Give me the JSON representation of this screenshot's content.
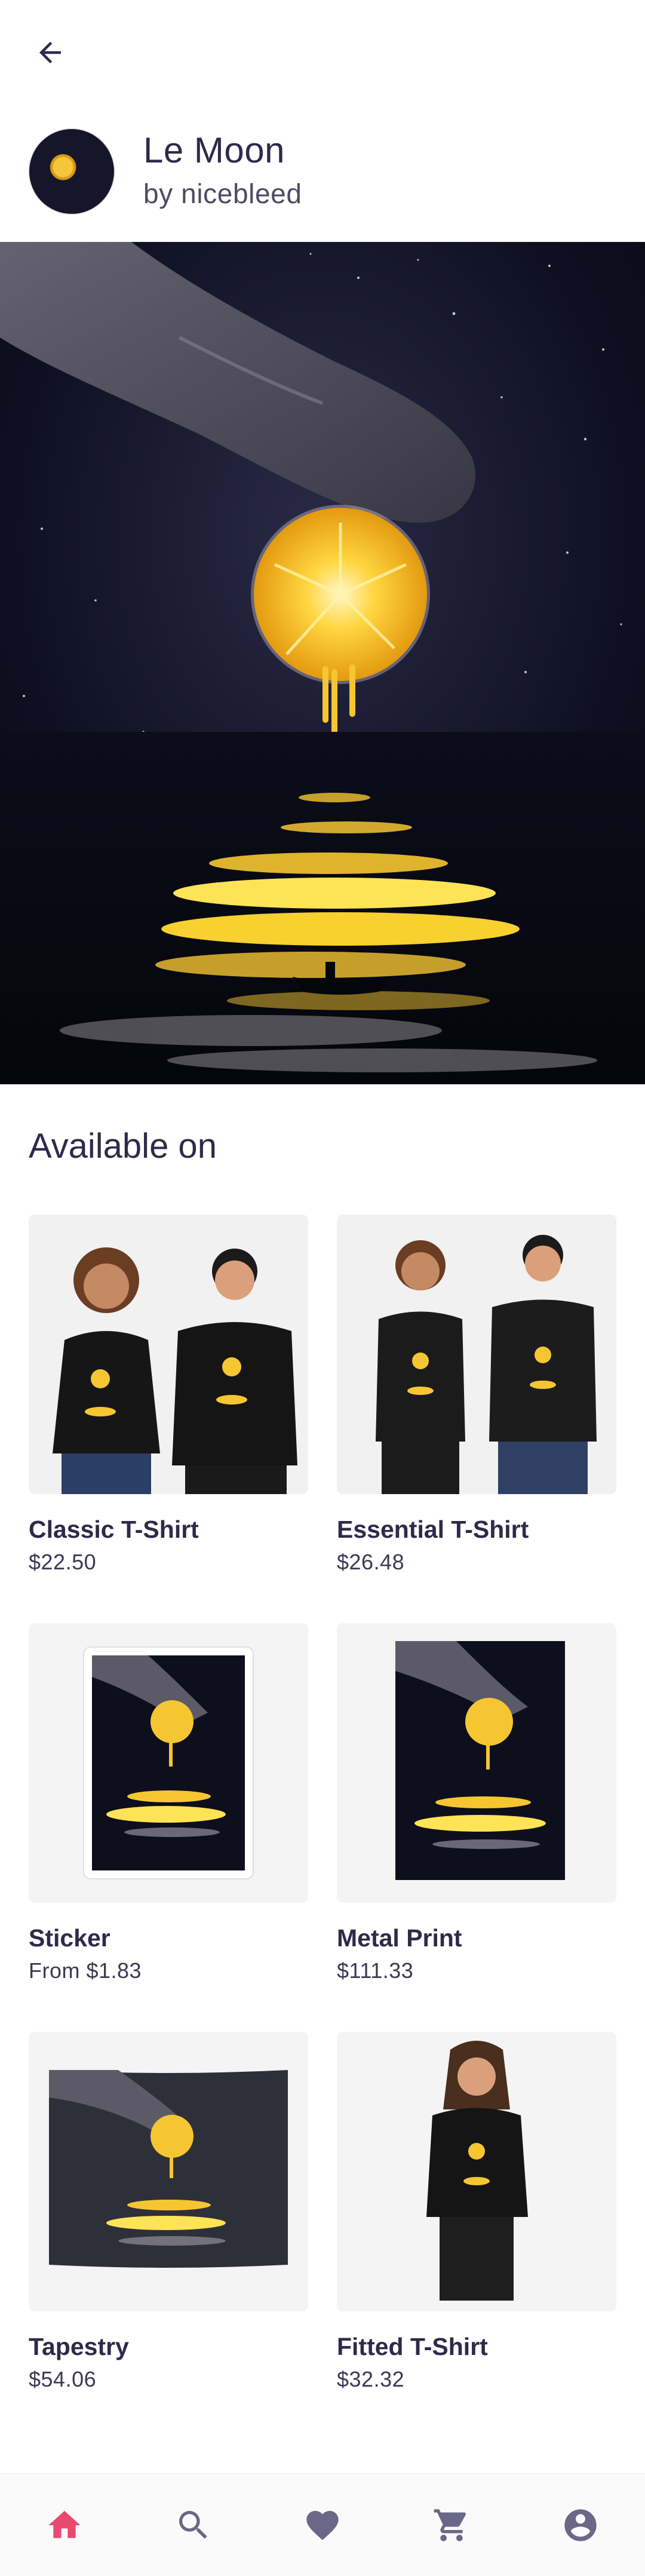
{
  "header": {
    "title": "Le Moon",
    "artist": "by nicebleed"
  },
  "section": {
    "title": "Available on"
  },
  "products": [
    {
      "name": "Classic T-Shirt",
      "price": "$22.50"
    },
    {
      "name": "Essential T-Shirt",
      "price": "$26.48"
    },
    {
      "name": "Sticker",
      "price": "From $1.83"
    },
    {
      "name": "Metal Print",
      "price": "$111.33"
    },
    {
      "name": "Tapestry",
      "price": "$54.06"
    },
    {
      "name": "Fitted T-Shirt",
      "price": "$32.32"
    }
  ],
  "nav": {
    "items": [
      "home-icon",
      "search-icon",
      "heart-icon",
      "cart-icon",
      "account-icon"
    ],
    "active": "home-icon",
    "active_color": "#e84a6f",
    "inactive_color": "#6a6788"
  },
  "colors": {
    "text_dark": "#2e2a4a",
    "lemon": "#f6c632",
    "night": "#0d0f1c"
  }
}
